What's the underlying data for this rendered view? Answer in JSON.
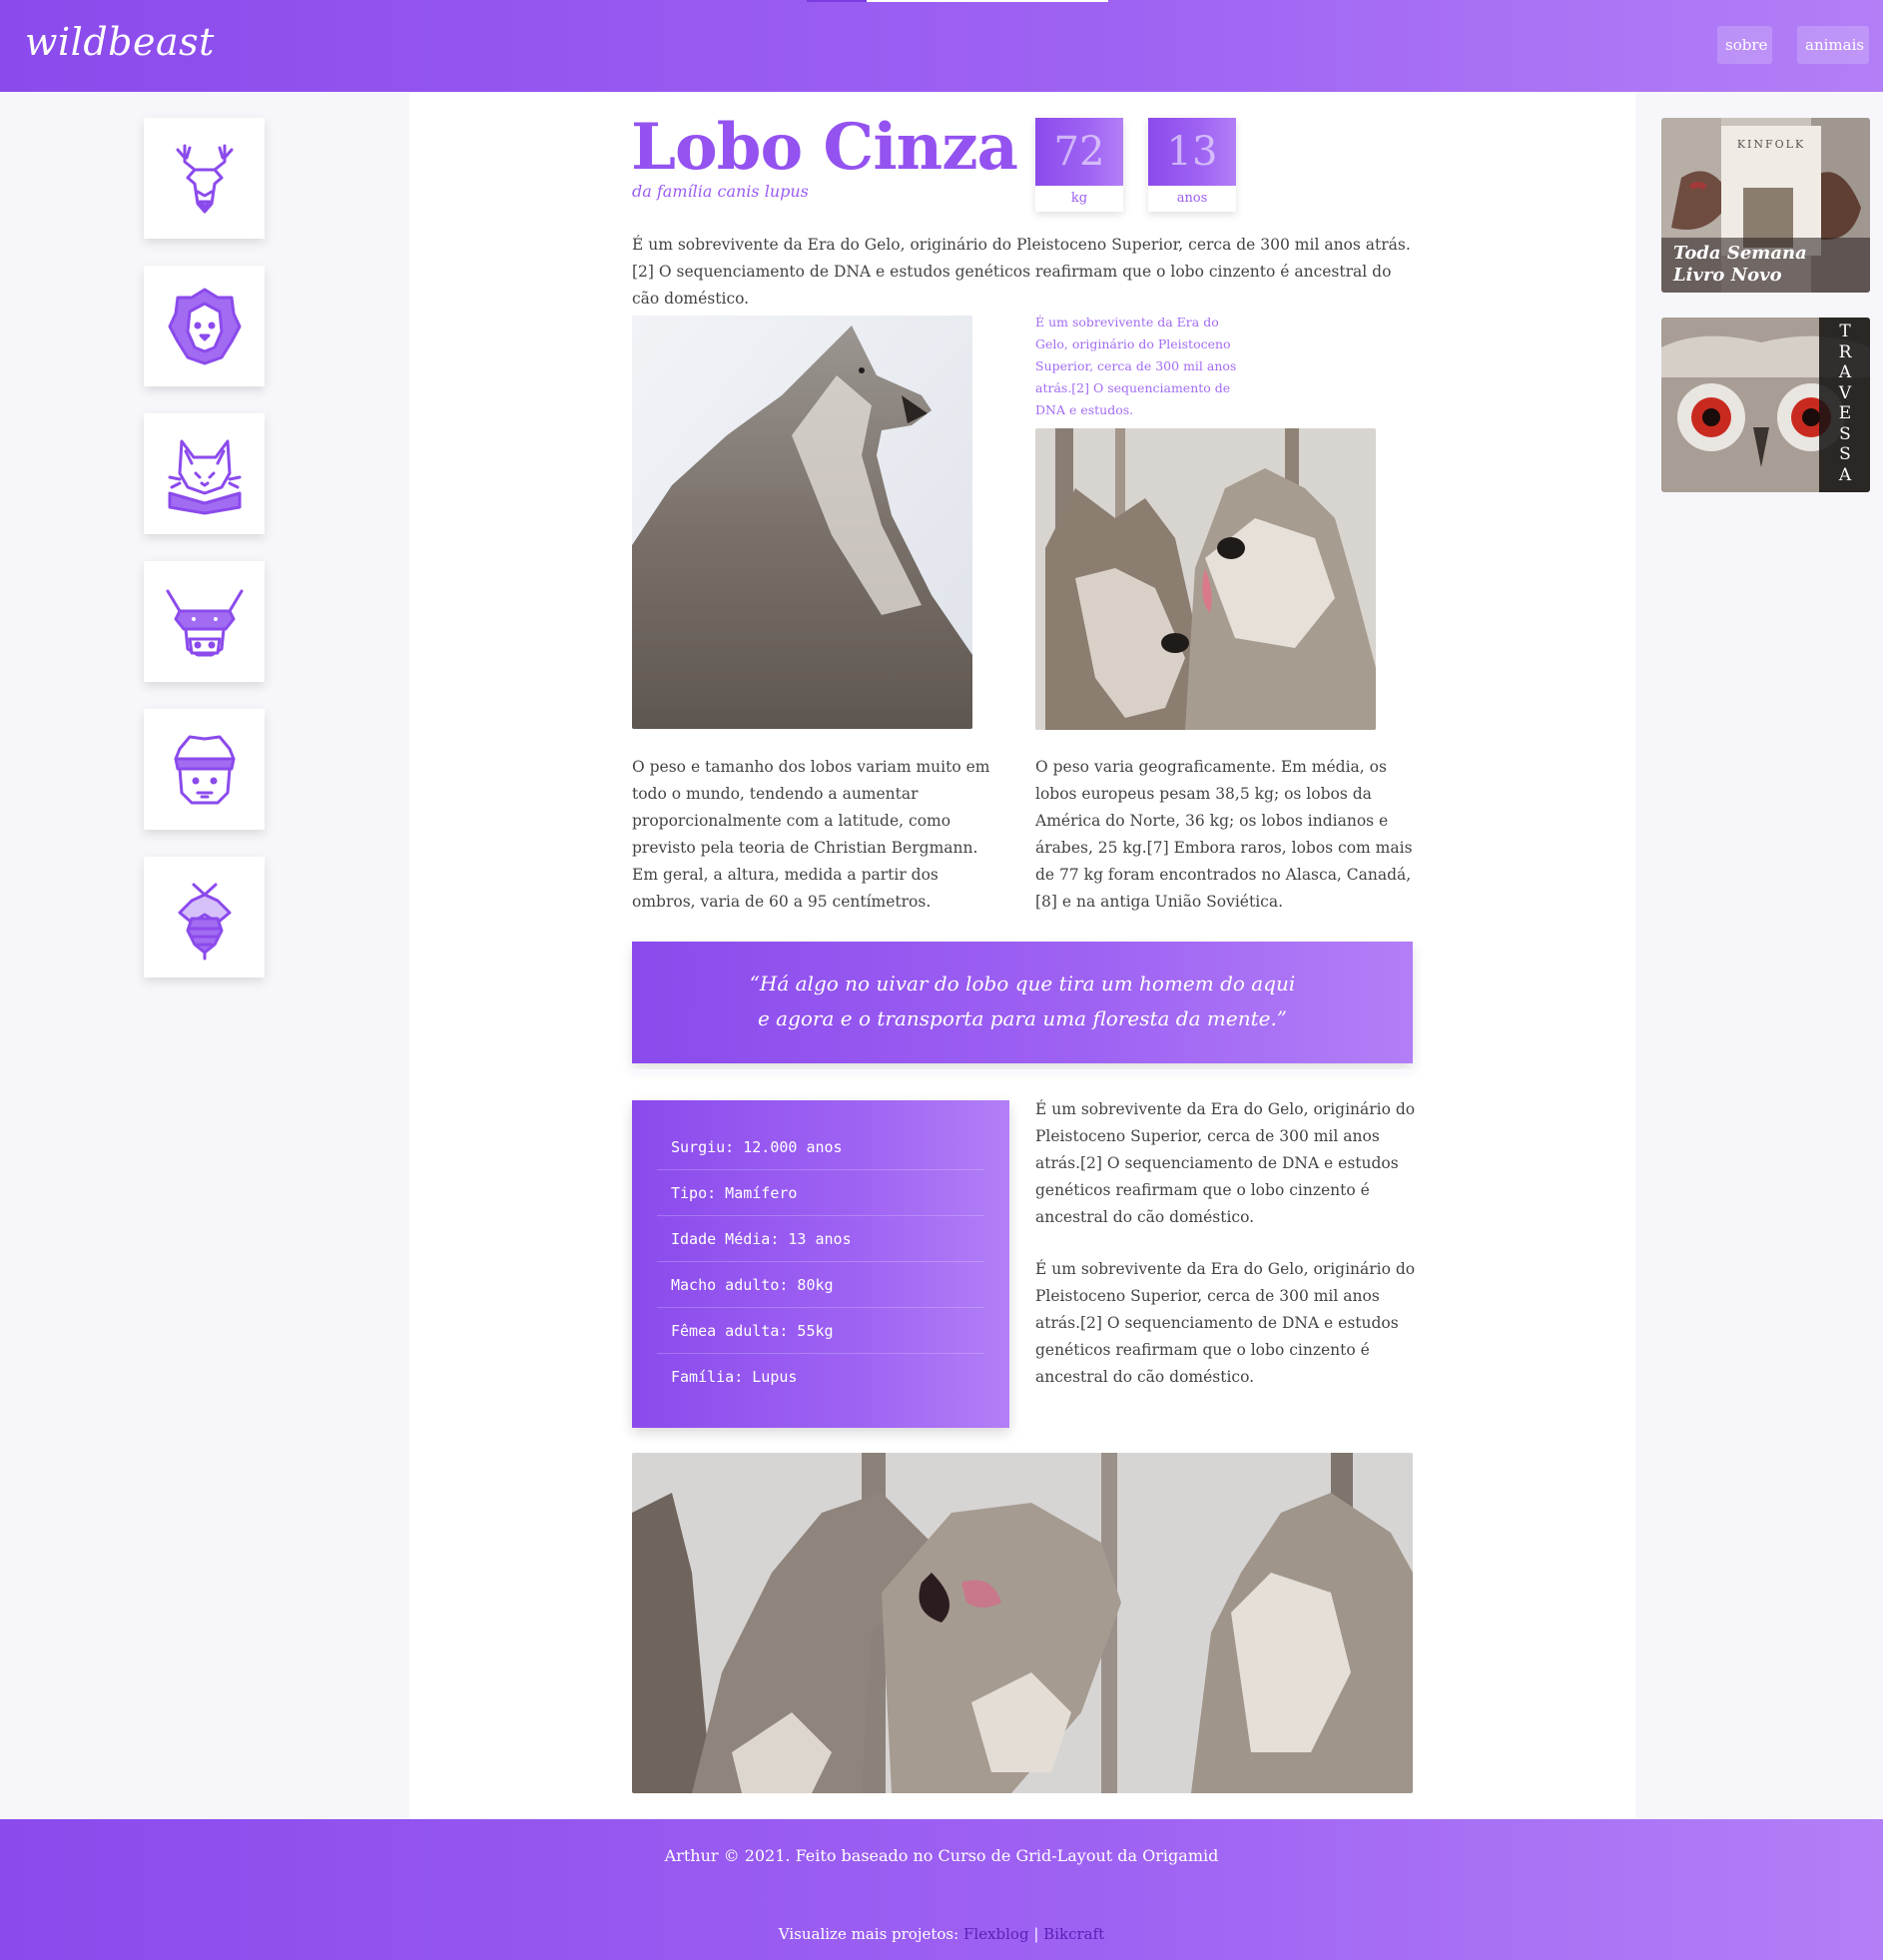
{
  "header": {
    "logo": "wildbeast",
    "nav": [
      "sobre",
      "animais"
    ]
  },
  "sidebar": {
    "icons": [
      "deer-icon",
      "lion-icon",
      "cat-icon",
      "cow-icon",
      "sheep-icon",
      "bee-icon"
    ]
  },
  "animal": {
    "name": "Lobo Cinza",
    "family": "da família canis lupus",
    "weight": "72",
    "weight_unit": "kg",
    "age": "13",
    "age_unit": "anos"
  },
  "content": {
    "intro": "É um sobrevivente da Era do Gelo, originário do Pleistoceno Superior, cerca de 300 mil anos atrás.[2] O sequenciamento de DNA e estudos genéticos reafirmam que o lobo cinzento é ancestral do cão doméstico.",
    "aside": "É um sobrevivente da Era do Gelo, originário do Pleistoceno Superior, cerca de 300 mil anos atrás.[2] O sequenciamento de DNA e estudos.",
    "col1": "O peso e tamanho dos lobos variam muito em todo o mundo, tendendo a aumentar proporcionalmente com a latitude, como previsto pela teoria de Christian Bergmann. Em geral, a altura, medida a partir dos ombros, varia de 60 a 95 centímetros.",
    "col2": "O peso varia geograficamente. Em média, os lobos europeus pesam 38,5 kg; os lobos da América do Norte, 36 kg; os lobos indianos e árabes, 25 kg.[7] Embora raros, lobos com mais de 77 kg foram encontrados no Alasca, Canadá,[8] e na antiga União Soviética.",
    "quote_line1": "“Há algo no uivar do lobo que tira um homem do aqui",
    "quote_line2": "e agora e o transporta para uma floresta da mente.”",
    "facts": [
      "Surgiu: 12.000 anos",
      "Tipo: Mamífero",
      "Idade Média: 13 anos",
      "Macho adulto: 80kg",
      "Fêmea adulta: 55kg",
      "Família: Lupus"
    ],
    "side1": "É um sobrevivente da Era do Gelo, originário do Pleistoceno Superior, cerca de 300 mil anos atrás.[2] O sequenciamento de DNA e estudos genéticos reafirmam que o lobo cinzento é ancestral do cão doméstico.",
    "side2": "É um sobrevivente da Era do Gelo, originário do Pleistoceno Superior, cerca de 300 mil anos atrás.[2] O sequenciamento de DNA e estudos genéticos reafirmam que o lobo cinzento é ancestral do cão doméstico."
  },
  "ads": {
    "kinfolk_brand": "KINFOLK",
    "kinfolk_line1": "Toda Semana",
    "kinfolk_line2": "Livro Novo",
    "travessa": "TRAVESSA"
  },
  "footer": {
    "credit": "Arthur © 2021. Feito baseado no Curso de Grid-Layout da Origamid",
    "more_label": "Visualize mais projetos:",
    "link1": "Flexblog",
    "separator": "|",
    "link2": "Bikcraft"
  },
  "colors": {
    "accent": "#9452f0",
    "accent_dark": "#8b4aec",
    "accent_light": "#b27ff7"
  }
}
